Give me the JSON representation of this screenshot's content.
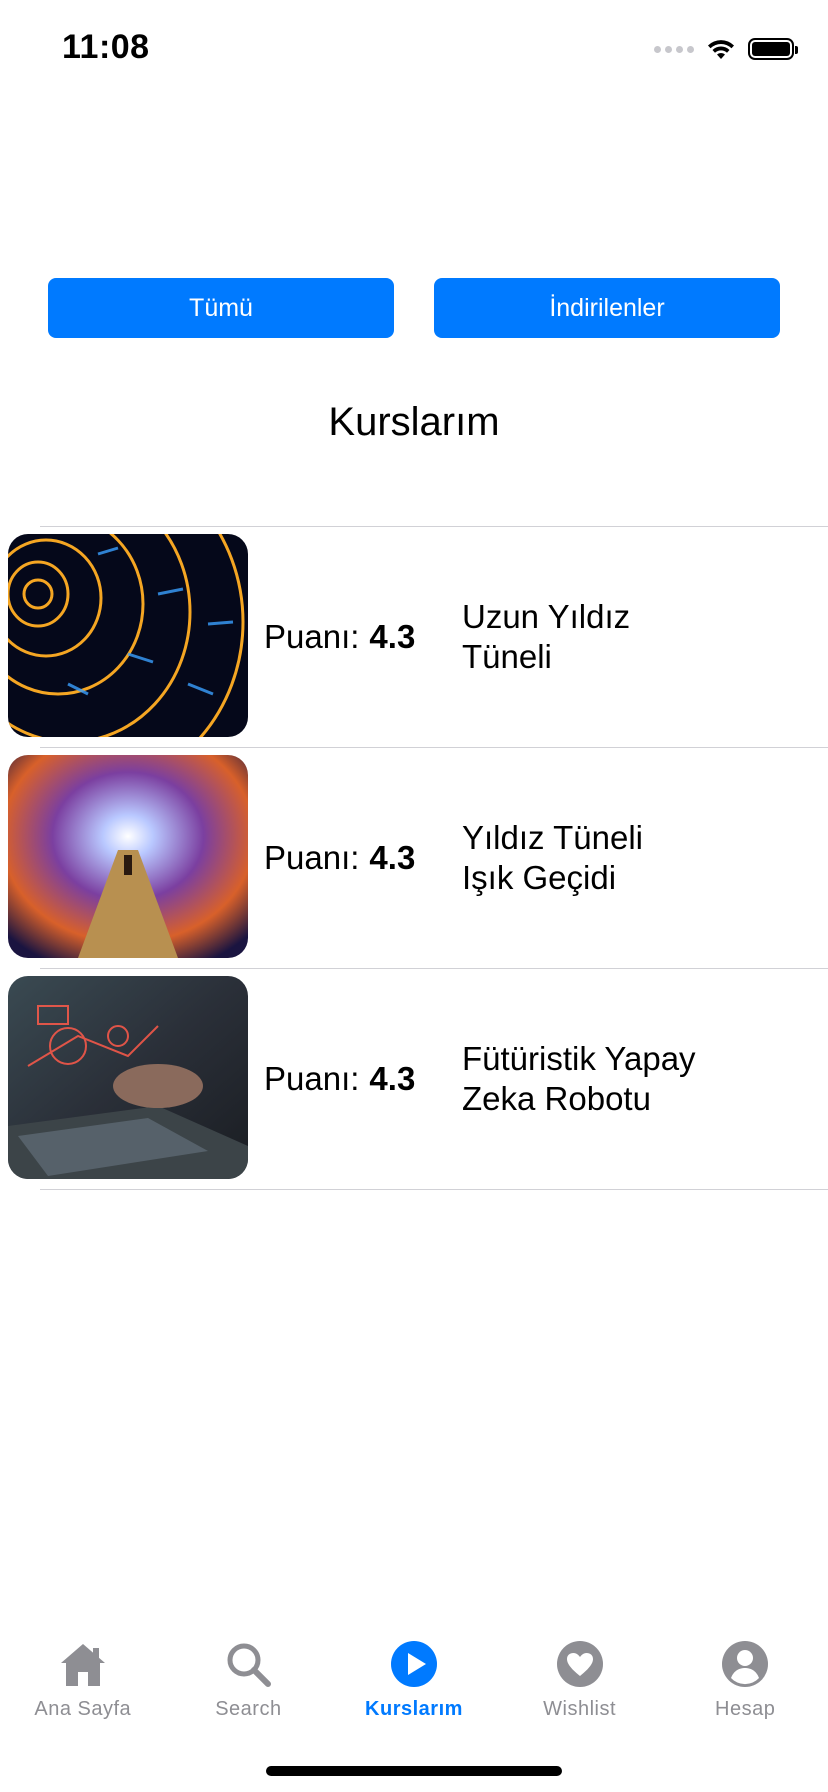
{
  "status_bar": {
    "time": "11:08"
  },
  "segments": {
    "all_label": "Tümü",
    "downloaded_label": "İndirilenler"
  },
  "page_title": "Kurslarım",
  "rating_label": "Puanı:",
  "courses": [
    {
      "rating": "4.3",
      "title": "Uzun Yıldız\nTüneli",
      "thumbnail": "star-tunnel-image"
    },
    {
      "rating": "4.3",
      "title": "Yıldız Tüneli\nIşık Geçidi",
      "thumbnail": "light-gate-image"
    },
    {
      "rating": "4.3",
      "title": "Fütüristik Yapay\nZeka Robotu",
      "thumbnail": "ai-laptop-image"
    }
  ],
  "tabs": [
    {
      "label": "Ana Sayfa",
      "icon": "home-icon"
    },
    {
      "label": "Search",
      "icon": "search-icon"
    },
    {
      "label": "Kurslarım",
      "icon": "play-circle-icon",
      "active": true
    },
    {
      "label": "Wishlist",
      "icon": "heart-circle-icon"
    },
    {
      "label": "Hesap",
      "icon": "person-circle-icon"
    }
  ],
  "colors": {
    "accent": "#007AFF",
    "inactive": "#8e8e93"
  }
}
